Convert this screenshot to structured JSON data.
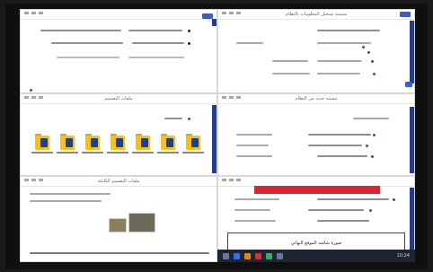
{
  "windows": [
    {
      "id": "top-left",
      "title": ""
    },
    {
      "id": "top-right",
      "title": "مستند تسجيل المعلومات بالنظام"
    },
    {
      "id": "mid-left",
      "title": "ملفات التصميم"
    },
    {
      "id": "mid-right",
      "title": "مستند جديد من النظام"
    },
    {
      "id": "bot-left",
      "title": "ملفات التصميم الكاملة"
    },
    {
      "id": "bot-right",
      "title": ""
    }
  ],
  "bottom_right_box_text": "صورة شاشة الموقع النهائي",
  "taskbar": {
    "time": "10:24"
  },
  "colors": {
    "accent_blue": "#233c8c",
    "red_bar": "#e0242f",
    "folder_yellow": "#f2c21a"
  }
}
